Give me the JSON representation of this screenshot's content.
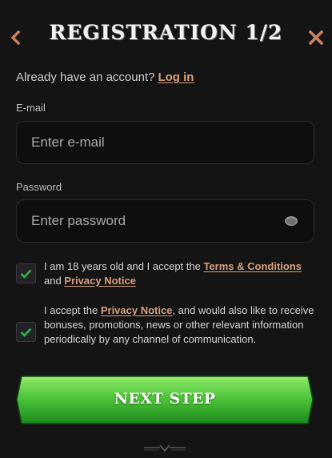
{
  "header": {
    "title": "REGISTRATION 1/2",
    "back_icon": "chevron-left-icon",
    "close_icon": "close-icon"
  },
  "login_prompt": {
    "text": "Already have an account?",
    "link": "Log in"
  },
  "email": {
    "label": "E-mail",
    "placeholder": "Enter e-mail",
    "value": ""
  },
  "password": {
    "label": "Password",
    "placeholder": "Enter password",
    "value": "",
    "toggle_icon": "eye-icon"
  },
  "consents": [
    {
      "checked": true,
      "text_before": "I am 18 years old and I accept the",
      "link_1": "Terms & Conditions",
      "text_middle": "and",
      "link_2": "Privacy Notice"
    },
    {
      "checked": true,
      "text_before": "I accept the",
      "link_1": "Privacy Notice",
      "text_after": ", and would also like to receive bonuses, promotions, news or other relevant information periodically by any channel of communication."
    }
  ],
  "next_button": {
    "label": "NEXT STEP"
  },
  "colors": {
    "background": "#141414",
    "accent_link": "#d9a07e",
    "accent_icon": "#c8845f",
    "check_green": "#33b24a",
    "button_green_top": "#7fe05a",
    "button_green_bottom": "#1f8a20"
  }
}
